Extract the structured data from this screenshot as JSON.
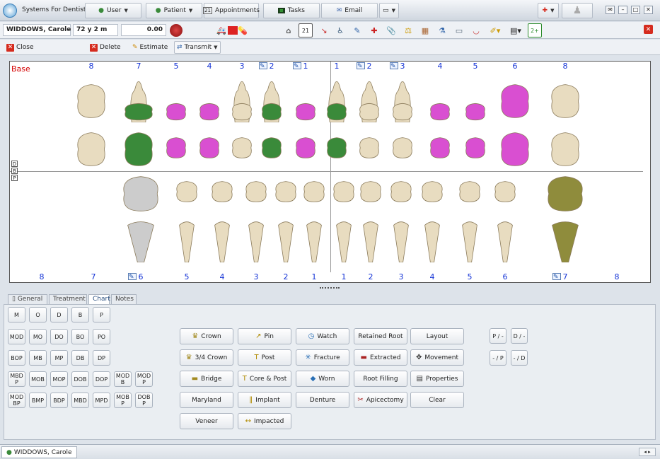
{
  "app": {
    "title": "Systems For Dentists"
  },
  "toolbar": {
    "user": "User",
    "patient": "Patient",
    "appointments": "Appointments",
    "tasks": "Tasks",
    "email": "Email"
  },
  "patient": {
    "name": "WIDDOWS, Carole",
    "age": "72 y 2 m",
    "balance": "0.00"
  },
  "actions": {
    "close": "Close",
    "delete": "Delete",
    "estimate": "Estimate",
    "transmit": "Transmit"
  },
  "chart": {
    "base_label": "Base",
    "upper_numbers": [
      "8",
      "7",
      "5",
      "4",
      "3",
      "2",
      "1",
      "1",
      "2",
      "3",
      "4",
      "5",
      "6",
      "8"
    ],
    "lower_numbers": [
      "8",
      "7",
      "6",
      "5",
      "4",
      "3",
      "2",
      "1",
      "1",
      "2",
      "3",
      "4",
      "5",
      "6",
      "7",
      "8"
    ],
    "surface_labels": [
      "D",
      "B",
      "P"
    ]
  },
  "tabs": [
    "General",
    "Treatment",
    "Chart",
    "Notes"
  ],
  "surfaces": {
    "row1": [
      "M",
      "O",
      "D",
      "B",
      "P"
    ],
    "row2": [
      "MOD",
      "MO",
      "DO",
      "BO",
      "PO"
    ],
    "row3": [
      "BOP",
      "MB",
      "MP",
      "DB",
      "DP"
    ],
    "row4": [
      "MBD P",
      "MOB",
      "MOP",
      "DOB",
      "DOP",
      "MOD B",
      "MOD P"
    ],
    "row5": [
      "MOD BP",
      "BMP",
      "BDP",
      "MBD",
      "MPD",
      "MOB P",
      "DOB P"
    ]
  },
  "treatments": {
    "col1": [
      "Crown",
      "3/4 Crown",
      "Bridge",
      "Maryland",
      "Veneer"
    ],
    "col2": [
      "Pin",
      "Post",
      "Core & Post",
      "Implant",
      "Impacted"
    ],
    "col3": [
      "Watch",
      "Fracture",
      "Worn",
      "Denture"
    ],
    "col4": [
      "Retained Root",
      "Extracted",
      "Root Filling",
      "Apicectomy"
    ],
    "col5": [
      "Layout",
      "Movement",
      "Properties",
      "Clear"
    ]
  },
  "quadrants": [
    "P / -",
    "D / -",
    "- / P",
    "- / D"
  ],
  "status": {
    "patient_tab": "WIDDOWS, Carole",
    "calendar_day": "21"
  },
  "colors": {
    "green": "#3a8a3a",
    "magenta": "#d94fd1",
    "blue": "#1a3fd0",
    "olive": "#8f8c3c",
    "red_label": "#d40000"
  }
}
